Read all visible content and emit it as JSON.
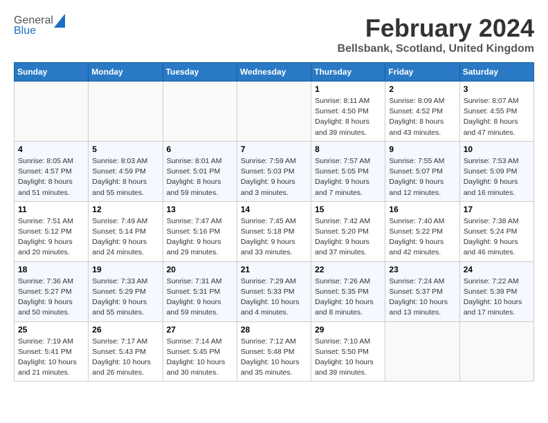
{
  "header": {
    "logo_general": "General",
    "logo_blue": "Blue",
    "month_title": "February 2024",
    "location": "Bellsbank, Scotland, United Kingdom"
  },
  "weekdays": [
    "Sunday",
    "Monday",
    "Tuesday",
    "Wednesday",
    "Thursday",
    "Friday",
    "Saturday"
  ],
  "weeks": [
    [
      {
        "day": "",
        "info": ""
      },
      {
        "day": "",
        "info": ""
      },
      {
        "day": "",
        "info": ""
      },
      {
        "day": "",
        "info": ""
      },
      {
        "day": "1",
        "info": "Sunrise: 8:11 AM\nSunset: 4:50 PM\nDaylight: 8 hours\nand 39 minutes."
      },
      {
        "day": "2",
        "info": "Sunrise: 8:09 AM\nSunset: 4:52 PM\nDaylight: 8 hours\nand 43 minutes."
      },
      {
        "day": "3",
        "info": "Sunrise: 8:07 AM\nSunset: 4:55 PM\nDaylight: 8 hours\nand 47 minutes."
      }
    ],
    [
      {
        "day": "4",
        "info": "Sunrise: 8:05 AM\nSunset: 4:57 PM\nDaylight: 8 hours\nand 51 minutes."
      },
      {
        "day": "5",
        "info": "Sunrise: 8:03 AM\nSunset: 4:59 PM\nDaylight: 8 hours\nand 55 minutes."
      },
      {
        "day": "6",
        "info": "Sunrise: 8:01 AM\nSunset: 5:01 PM\nDaylight: 8 hours\nand 59 minutes."
      },
      {
        "day": "7",
        "info": "Sunrise: 7:59 AM\nSunset: 5:03 PM\nDaylight: 9 hours\nand 3 minutes."
      },
      {
        "day": "8",
        "info": "Sunrise: 7:57 AM\nSunset: 5:05 PM\nDaylight: 9 hours\nand 7 minutes."
      },
      {
        "day": "9",
        "info": "Sunrise: 7:55 AM\nSunset: 5:07 PM\nDaylight: 9 hours\nand 12 minutes."
      },
      {
        "day": "10",
        "info": "Sunrise: 7:53 AM\nSunset: 5:09 PM\nDaylight: 9 hours\nand 16 minutes."
      }
    ],
    [
      {
        "day": "11",
        "info": "Sunrise: 7:51 AM\nSunset: 5:12 PM\nDaylight: 9 hours\nand 20 minutes."
      },
      {
        "day": "12",
        "info": "Sunrise: 7:49 AM\nSunset: 5:14 PM\nDaylight: 9 hours\nand 24 minutes."
      },
      {
        "day": "13",
        "info": "Sunrise: 7:47 AM\nSunset: 5:16 PM\nDaylight: 9 hours\nand 29 minutes."
      },
      {
        "day": "14",
        "info": "Sunrise: 7:45 AM\nSunset: 5:18 PM\nDaylight: 9 hours\nand 33 minutes."
      },
      {
        "day": "15",
        "info": "Sunrise: 7:42 AM\nSunset: 5:20 PM\nDaylight: 9 hours\nand 37 minutes."
      },
      {
        "day": "16",
        "info": "Sunrise: 7:40 AM\nSunset: 5:22 PM\nDaylight: 9 hours\nand 42 minutes."
      },
      {
        "day": "17",
        "info": "Sunrise: 7:38 AM\nSunset: 5:24 PM\nDaylight: 9 hours\nand 46 minutes."
      }
    ],
    [
      {
        "day": "18",
        "info": "Sunrise: 7:36 AM\nSunset: 5:27 PM\nDaylight: 9 hours\nand 50 minutes."
      },
      {
        "day": "19",
        "info": "Sunrise: 7:33 AM\nSunset: 5:29 PM\nDaylight: 9 hours\nand 55 minutes."
      },
      {
        "day": "20",
        "info": "Sunrise: 7:31 AM\nSunset: 5:31 PM\nDaylight: 9 hours\nand 59 minutes."
      },
      {
        "day": "21",
        "info": "Sunrise: 7:29 AM\nSunset: 5:33 PM\nDaylight: 10 hours\nand 4 minutes."
      },
      {
        "day": "22",
        "info": "Sunrise: 7:26 AM\nSunset: 5:35 PM\nDaylight: 10 hours\nand 8 minutes."
      },
      {
        "day": "23",
        "info": "Sunrise: 7:24 AM\nSunset: 5:37 PM\nDaylight: 10 hours\nand 13 minutes."
      },
      {
        "day": "24",
        "info": "Sunrise: 7:22 AM\nSunset: 5:39 PM\nDaylight: 10 hours\nand 17 minutes."
      }
    ],
    [
      {
        "day": "25",
        "info": "Sunrise: 7:19 AM\nSunset: 5:41 PM\nDaylight: 10 hours\nand 21 minutes."
      },
      {
        "day": "26",
        "info": "Sunrise: 7:17 AM\nSunset: 5:43 PM\nDaylight: 10 hours\nand 26 minutes."
      },
      {
        "day": "27",
        "info": "Sunrise: 7:14 AM\nSunset: 5:45 PM\nDaylight: 10 hours\nand 30 minutes."
      },
      {
        "day": "28",
        "info": "Sunrise: 7:12 AM\nSunset: 5:48 PM\nDaylight: 10 hours\nand 35 minutes."
      },
      {
        "day": "29",
        "info": "Sunrise: 7:10 AM\nSunset: 5:50 PM\nDaylight: 10 hours\nand 39 minutes."
      },
      {
        "day": "",
        "info": ""
      },
      {
        "day": "",
        "info": ""
      }
    ]
  ]
}
